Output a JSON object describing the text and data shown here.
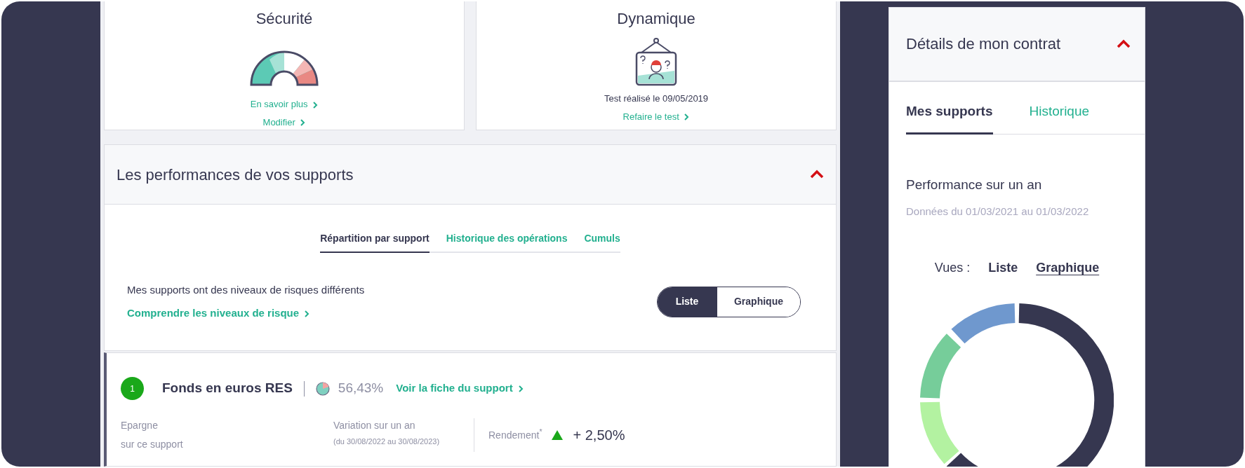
{
  "profile_cards": [
    {
      "kind": "gauge",
      "title": "Sécurité",
      "links": [
        "En savoir plus",
        "Modifier"
      ]
    },
    {
      "kind": "test",
      "title": "Dynamique",
      "note": "Test réalisé le 09/05/2019",
      "links": [
        "Refaire le test"
      ]
    }
  ],
  "performance": {
    "title": "Les performances de vos supports",
    "expanded": true,
    "tabs": [
      {
        "label": "Répartition par support",
        "selected": true
      },
      {
        "label": "Historique des opérations",
        "selected": false
      },
      {
        "label": "Cumuls",
        "selected": false
      }
    ],
    "risk_text": "Mes supports ont des niveaux de risques différents",
    "risk_link": "Comprendre les niveaux de risque",
    "view_toggle": [
      {
        "label": "Liste",
        "selected": true
      },
      {
        "label": "Graphique",
        "selected": false
      }
    ]
  },
  "fund": {
    "number": "1",
    "name": "Fonds en euros RES",
    "share": "56,43%",
    "link": "Voir la fiche du support",
    "savings_label": [
      "Epargne",
      "sur ce support"
    ],
    "variation_label": "Variation sur un an",
    "variation_period": "(du 30/08/2022 au 30/08/2023)",
    "yield_label": "Rendement$^{*}$",
    "trend_up": true,
    "yield_value": "+ 2,50%"
  },
  "contract": {
    "title": "Détails de mon contrat",
    "expanded": true,
    "tabs": [
      {
        "label": "Mes supports",
        "selected": true
      },
      {
        "label": "Historique",
        "selected": false
      }
    ],
    "perf_title": "Performance sur un an",
    "period": "Données du 01/03/2021 au 01/03/2022",
    "views_label": "Vues :",
    "views": [
      {
        "label": "Liste",
        "selected": false
      },
      {
        "label": "Graphique",
        "selected": true
      }
    ]
  }
}
